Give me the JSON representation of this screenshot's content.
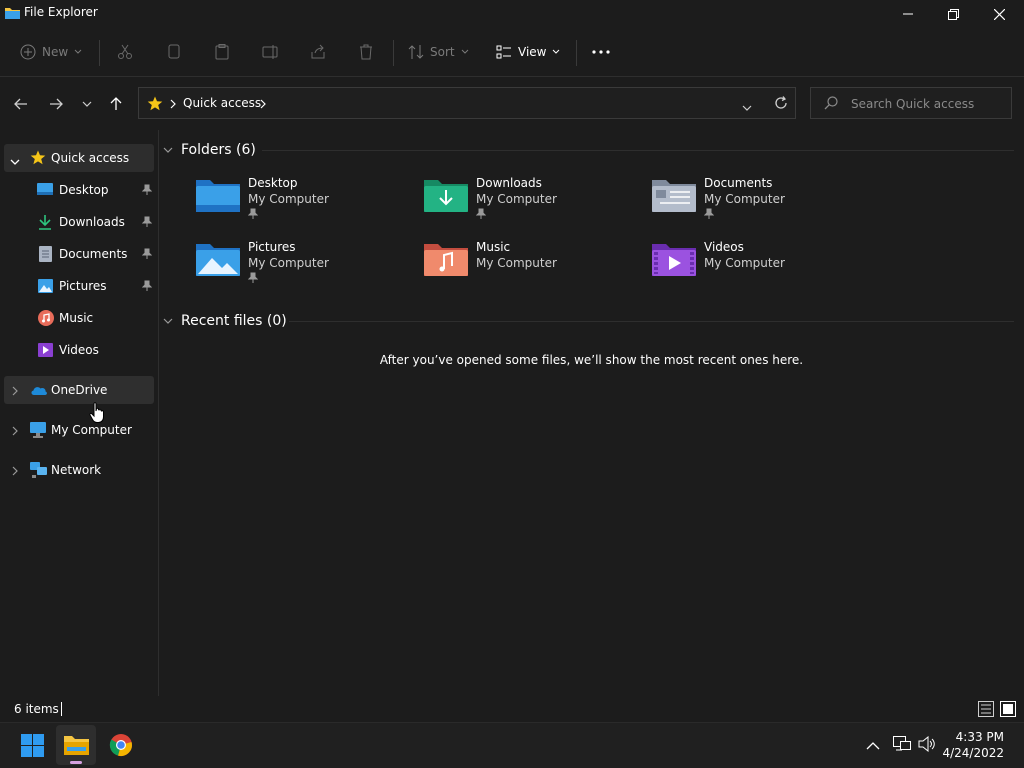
{
  "window": {
    "title": "File Explorer"
  },
  "toolbar": {
    "new_label": "New",
    "sort_label": "Sort",
    "view_label": "View"
  },
  "address": {
    "location": "Quick access"
  },
  "search": {
    "placeholder": "Search Quick access"
  },
  "sidebar": {
    "quick_access": "Quick access",
    "items": [
      {
        "label": "Desktop",
        "pinned": true
      },
      {
        "label": "Downloads",
        "pinned": true
      },
      {
        "label": "Documents",
        "pinned": true
      },
      {
        "label": "Pictures",
        "pinned": true
      },
      {
        "label": "Music",
        "pinned": false
      },
      {
        "label": "Videos",
        "pinned": false
      }
    ],
    "onedrive": "OneDrive",
    "my_computer": "My Computer",
    "network": "Network"
  },
  "main": {
    "folders_header": "Folders (6)",
    "folders": [
      {
        "name": "Desktop",
        "location": "My Computer",
        "pinned": true
      },
      {
        "name": "Downloads",
        "location": "My Computer",
        "pinned": true
      },
      {
        "name": "Documents",
        "location": "My Computer",
        "pinned": true
      },
      {
        "name": "Pictures",
        "location": "My Computer",
        "pinned": true
      },
      {
        "name": "Music",
        "location": "My Computer",
        "pinned": false
      },
      {
        "name": "Videos",
        "location": "My Computer",
        "pinned": false
      }
    ],
    "recent_header": "Recent files (0)",
    "recent_empty": "After you’ve opened some files, we’ll show the most recent ones here."
  },
  "status": {
    "count": "6 items"
  },
  "taskbar": {
    "time": "4:33 PM",
    "date": "4/24/2022"
  },
  "colors": {
    "accent_folder": "#3aa0e8",
    "star": "#f5c518",
    "background": "#1c1c1c"
  }
}
